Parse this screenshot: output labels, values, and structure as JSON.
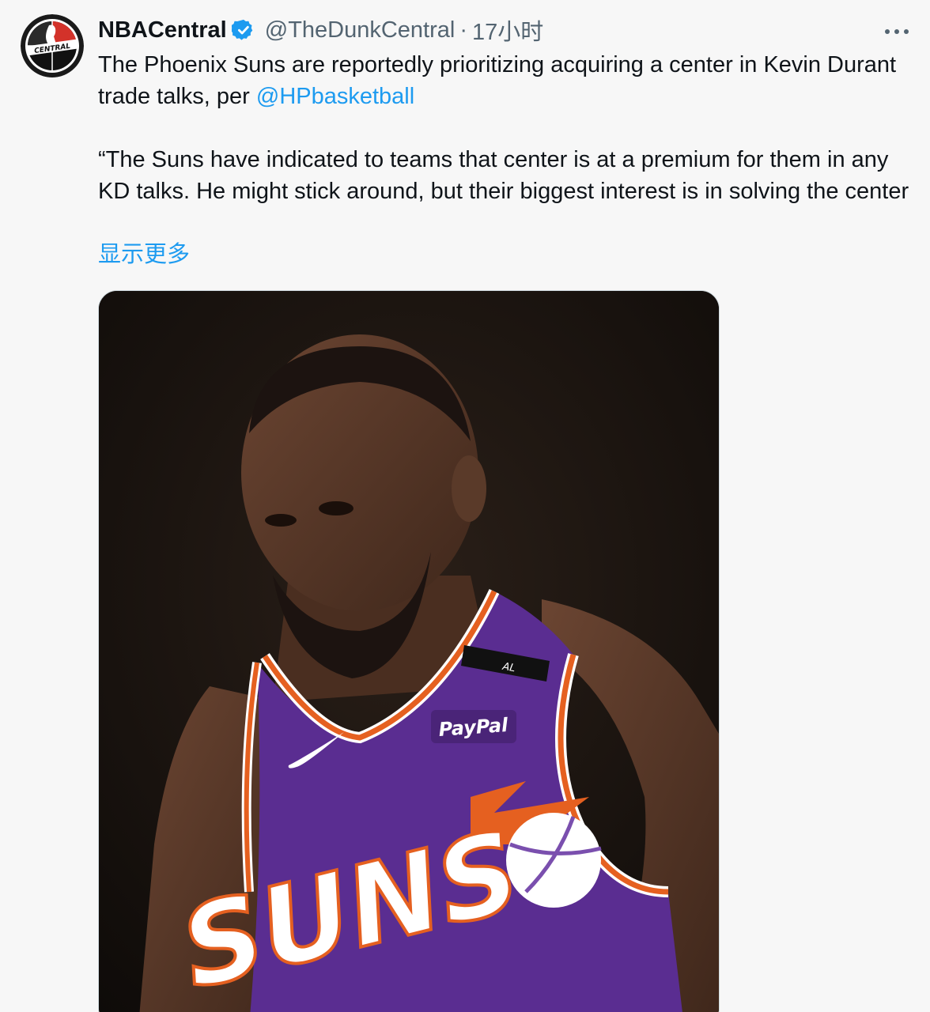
{
  "tweet": {
    "display_name": "NBACentral",
    "handle": "@TheDunkCentral",
    "separator": "·",
    "timestamp": "17小时",
    "text_before_mention": "The Phoenix Suns are reportedly prioritizing acquiring a center in Kevin Durant trade talks, per ",
    "mention": "@HPbasketball",
    "quote": "“The Suns have indicated to teams that center is at a premium for them in any KD talks. He might stick around, but their biggest interest is in solving the center",
    "show_more": "显示更多",
    "avatar_text": "CENTRAL",
    "media": {
      "jersey_text": "SUNS",
      "sponsor_patch": "PayPal",
      "armband_text": "AL"
    }
  },
  "icons": {
    "verified": "verified-badge-icon",
    "more": "more-options-icon"
  },
  "colors": {
    "link": "#1d9bf0",
    "secondary_text": "#536471",
    "background": "#f7f7f7",
    "jersey_purple": "#5a2d91",
    "jersey_orange": "#e56020"
  }
}
